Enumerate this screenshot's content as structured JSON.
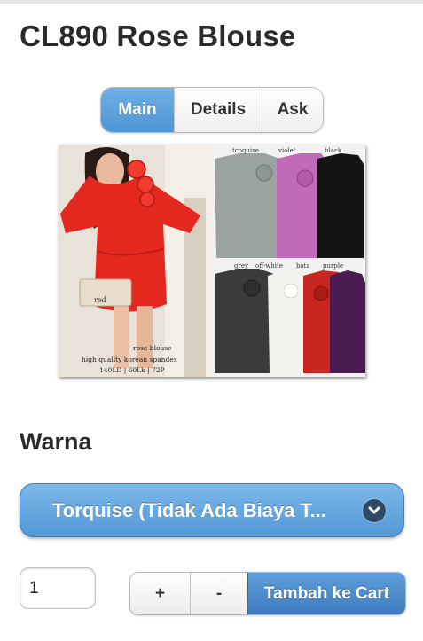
{
  "product": {
    "title": "CL890 Rose Blouse"
  },
  "tabs": [
    {
      "label": "Main",
      "active": true
    },
    {
      "label": "Details",
      "active": false
    },
    {
      "label": "Ask",
      "active": false
    }
  ],
  "image": {
    "colors_row1": [
      "tcoquise",
      "violet",
      "black"
    ],
    "colors_row2": [
      "grey",
      "off-white",
      "bata",
      "purple"
    ],
    "red_label": "red",
    "caption_1": "rose blouse",
    "caption_2": "high quality korean spandex",
    "caption_3": "140LD | 60Lk | 72P"
  },
  "option": {
    "label": "Warna",
    "selected": "Torquise (Tidak Ada Biaya T...",
    "chevron_icon": "chevron-down-icon"
  },
  "quantity": {
    "value": "1"
  },
  "controls": {
    "plus_label": "+",
    "minus_label": "-",
    "cart_label": "Tambah ke Cart"
  },
  "colors": {
    "accent": "#5398d6",
    "cart": "#3d7bbf"
  }
}
